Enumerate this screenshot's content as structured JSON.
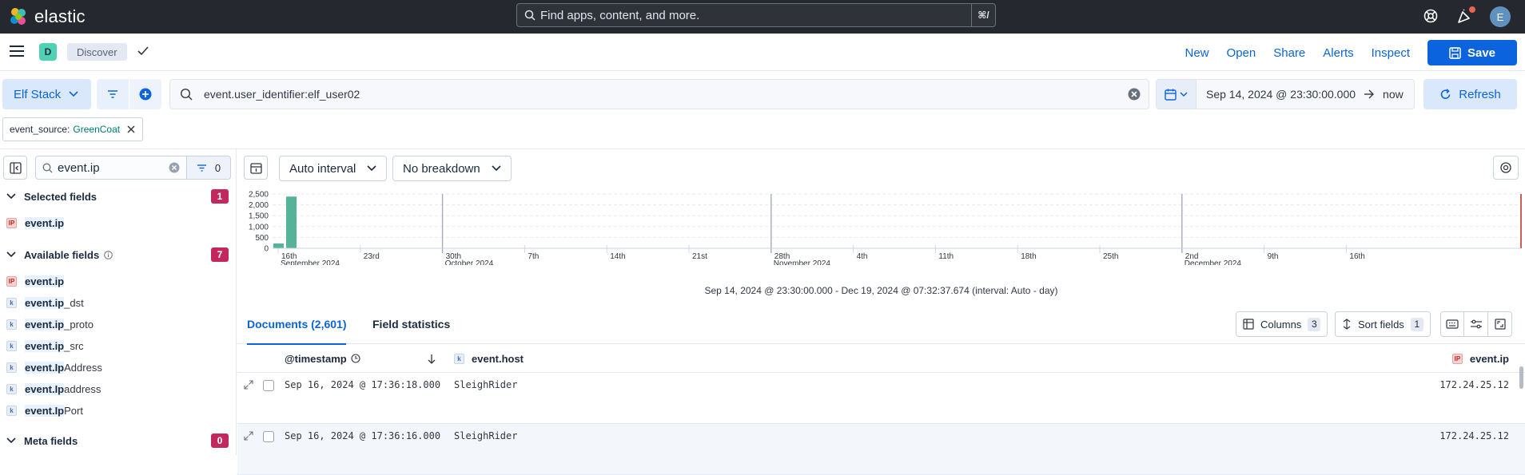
{
  "header": {
    "brand": "elastic",
    "search_placeholder": "Find apps, content, and more.",
    "search_shortcut": "⌘/",
    "avatar_initial": "E",
    "colors": {
      "bg": "#25282f",
      "notification": "#e7664c"
    }
  },
  "appbar": {
    "space_initial": "D",
    "breadcrumb": "Discover",
    "nav": [
      "New",
      "Open",
      "Share",
      "Alerts",
      "Inspect"
    ],
    "save_label": "Save"
  },
  "querybar": {
    "data_view": "Elf Stack",
    "query": "event.user_identifier:elf_user02",
    "date_start": "Sep 14, 2024 @ 23:30:00.000",
    "date_end": "now",
    "refresh_label": "Refresh"
  },
  "filter_pill": {
    "field": "event_source: ",
    "value": "GreenCoat"
  },
  "sidebar": {
    "search_value": "event.ip",
    "filter_count": "0",
    "selected": {
      "title": "Selected fields",
      "count": "1",
      "fields": [
        {
          "type": "ip",
          "hl": "event.ip",
          "rest": ""
        }
      ]
    },
    "available": {
      "title": "Available fields",
      "count": "7",
      "fields": [
        {
          "type": "ip",
          "hl": "event.ip",
          "rest": ""
        },
        {
          "type": "k",
          "hl": "event.ip",
          "rest": "_dst"
        },
        {
          "type": "k",
          "hl": "event.ip",
          "rest": "_proto"
        },
        {
          "type": "k",
          "hl": "event.ip",
          "rest": "_src"
        },
        {
          "type": "k",
          "hl": "event.Ip",
          "rest": "Address"
        },
        {
          "type": "k",
          "hl": "event.Ip",
          "rest": "address"
        },
        {
          "type": "k",
          "hl": "event.Ip",
          "rest": "Port"
        }
      ]
    },
    "meta": {
      "title": "Meta fields",
      "count": "0"
    }
  },
  "chart_controls": {
    "interval": "Auto interval",
    "breakdown": "No breakdown"
  },
  "chart_data": {
    "type": "bar",
    "y_ticks": [
      "2,500",
      "2,000",
      "1,500",
      "1,000",
      "500",
      "0"
    ],
    "ylim": [
      0,
      2500
    ],
    "x_ticks": [
      {
        "label": "16th",
        "sub": "September 2024"
      },
      {
        "label": "23rd",
        "sub": ""
      },
      {
        "label": "30th",
        "sub": "October 2024"
      },
      {
        "label": "7th",
        "sub": ""
      },
      {
        "label": "14th",
        "sub": ""
      },
      {
        "label": "21st",
        "sub": ""
      },
      {
        "label": "28th",
        "sub": "November 2024"
      },
      {
        "label": "4th",
        "sub": ""
      },
      {
        "label": "11th",
        "sub": ""
      },
      {
        "label": "18th",
        "sub": ""
      },
      {
        "label": "25th",
        "sub": ""
      },
      {
        "label": "2nd",
        "sub": "December 2024"
      },
      {
        "label": "9th",
        "sub": ""
      },
      {
        "label": "16th",
        "sub": ""
      }
    ],
    "bars": [
      {
        "x": "Sep 15, 2024",
        "value": 220
      },
      {
        "x": "Sep 16, 2024",
        "value": 2381
      }
    ],
    "bar_color": "#54b399",
    "caption": "Sep 14, 2024 @ 23:30:00.000 - Dec 19, 2024 @ 07:32:37.674 (interval: Auto - day)"
  },
  "tabs": {
    "documents": "Documents (2,601)",
    "field_statistics": "Field statistics"
  },
  "toolbar": {
    "columns_label": "Columns",
    "columns_count": "3",
    "sort_label": "Sort fields",
    "sort_count": "1"
  },
  "grid": {
    "headers": {
      "timestamp": "@timestamp",
      "host": "event.host",
      "ip": "event.ip"
    },
    "rows": [
      {
        "timestamp": "Sep 16, 2024 @ 17:36:18.000",
        "host": "SleighRider",
        "ip": "172.24.25.12"
      },
      {
        "timestamp": "Sep 16, 2024 @ 17:36:16.000",
        "host": "SleighRider",
        "ip": "172.24.25.12"
      }
    ]
  }
}
